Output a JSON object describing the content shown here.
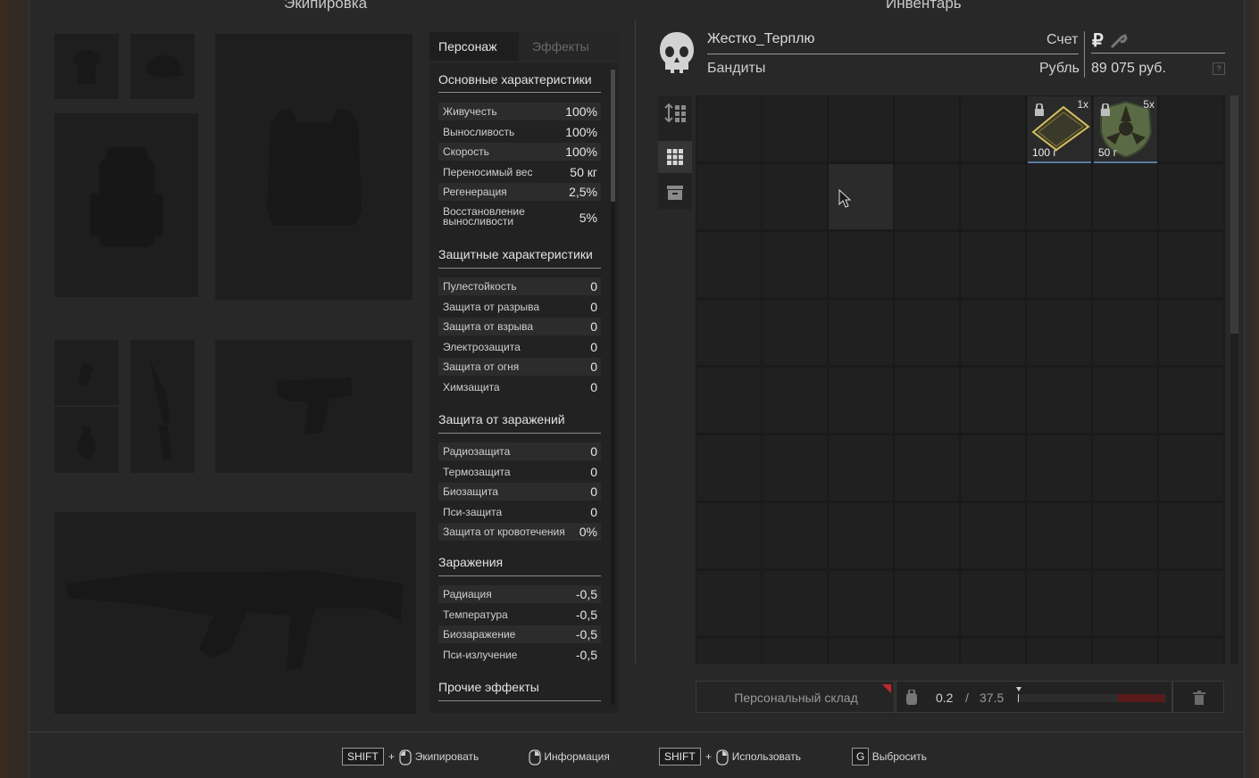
{
  "equipment": {
    "title": "Экипировка"
  },
  "inventory": {
    "title": "Инвентарь"
  },
  "tabs": {
    "character": "Персонаж",
    "effects": "Эффекты"
  },
  "stats": {
    "main": {
      "title": "Основные характеристики",
      "rows": [
        {
          "label": "Живучесть",
          "value": "100%"
        },
        {
          "label": "Выносливость",
          "value": "100%"
        },
        {
          "label": "Скорость",
          "value": "100%"
        },
        {
          "label": "Переносимый вес",
          "value": "50 кг"
        },
        {
          "label": "Регенерация",
          "value": "2,5%"
        },
        {
          "label": "Восстановление выносливости",
          "value": "5%"
        }
      ]
    },
    "defense": {
      "title": "Защитные характеристики",
      "rows": [
        {
          "label": "Пулестойкость",
          "value": "0"
        },
        {
          "label": "Защита от разрыва",
          "value": "0"
        },
        {
          "label": "Защита от взрыва",
          "value": "0"
        },
        {
          "label": "Электрозащита",
          "value": "0"
        },
        {
          "label": "Защита от огня",
          "value": "0"
        },
        {
          "label": "Химзащита",
          "value": "0"
        }
      ]
    },
    "contamination_protection": {
      "title": "Защита от заражений",
      "rows": [
        {
          "label": "Радиозащита",
          "value": "0"
        },
        {
          "label": "Термозащита",
          "value": "0"
        },
        {
          "label": "Биозащита",
          "value": "0"
        },
        {
          "label": "Пси-защита",
          "value": "0"
        },
        {
          "label": "Защита от кровотечения",
          "value": "0%"
        }
      ]
    },
    "contamination": {
      "title": "Заражения",
      "rows": [
        {
          "label": "Радиация",
          "value": "-0,5"
        },
        {
          "label": "Температура",
          "value": "-0,5"
        },
        {
          "label": "Биозаражение",
          "value": "-0,5"
        },
        {
          "label": "Пси-излучение",
          "value": "-0,5"
        }
      ]
    },
    "other": {
      "title": "Прочие эффекты"
    }
  },
  "player": {
    "name": "Жестко_Терплю",
    "faction": "Бандиты",
    "account_label": "Счет",
    "currency_label": "Рубль",
    "currency_symbol": "₽",
    "balance": "89 075 руб.",
    "help": "?"
  },
  "items": [
    {
      "name": "document-item",
      "count": "1x",
      "weight": "100 г",
      "locked": true
    },
    {
      "name": "bandit-patch-item",
      "count": "5x",
      "weight": "50 г",
      "locked": true
    }
  ],
  "storage": {
    "label": "Персональный склад"
  },
  "weight": {
    "current": "0.2",
    "sep": "/",
    "max": "37.5"
  },
  "hints": {
    "shift1": "SHIFT",
    "plus1": "+",
    "equip": "Экипировать",
    "info": "Информация",
    "shift2": "SHIFT",
    "plus2": "+",
    "use": "Использовать",
    "g": "G",
    "drop": "Выбросить"
  },
  "colors": {
    "accent_red": "#c0272d",
    "item_border": "#5b7ba0"
  }
}
